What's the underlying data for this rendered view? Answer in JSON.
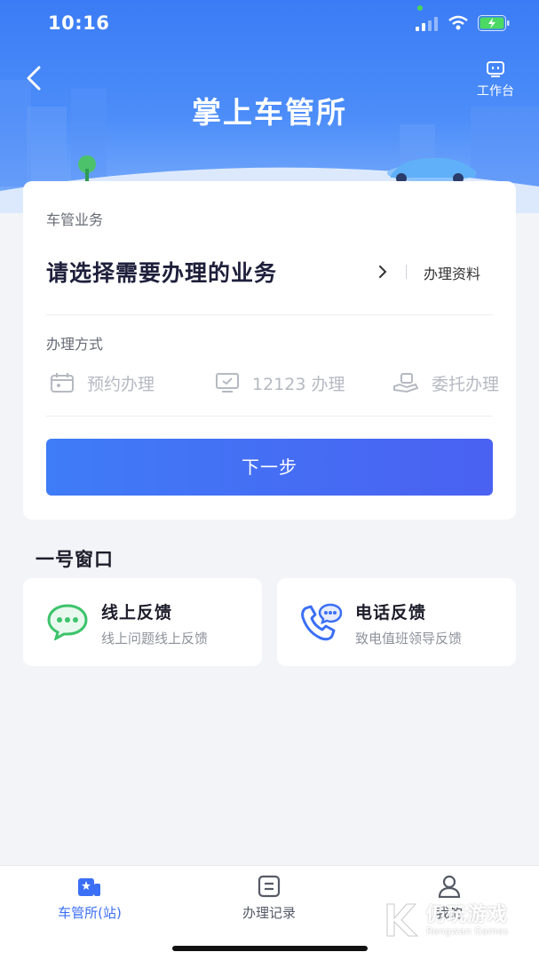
{
  "status_bar": {
    "time": "10:16"
  },
  "header": {
    "title": "掌上车管所",
    "workbench_label": "工作台"
  },
  "business": {
    "section_label": "车管业务",
    "select_prompt": "请选择需要办理的业务",
    "materials_link": "办理资料"
  },
  "methods": {
    "section_label": "办理方式",
    "items": [
      {
        "label": "预约办理",
        "icon": "calendar-icon"
      },
      {
        "label": "12123 办理",
        "icon": "monitor-icon"
      },
      {
        "label": "委托办理",
        "icon": "hand-icon"
      }
    ]
  },
  "next_button": "下一步",
  "window": {
    "title": "一号窗口",
    "cards": [
      {
        "title": "线上反馈",
        "subtitle": "线上问题线上反馈",
        "icon": "chat-bubble-icon"
      },
      {
        "title": "电话反馈",
        "subtitle": "致电值班领导反馈",
        "icon": "phone-chat-icon"
      }
    ]
  },
  "tabs": [
    {
      "label": "车管所(站)",
      "active": true,
      "icon": "station-icon"
    },
    {
      "label": "办理记录",
      "active": false,
      "icon": "record-icon"
    },
    {
      "label": "我的",
      "active": false,
      "icon": "user-icon"
    }
  ],
  "watermark": {
    "text": "仍玩游戏",
    "sub": "Rengwan Games"
  },
  "colors": {
    "primary": "#3f7cf7",
    "accent": "#4a61f1",
    "green": "#3cc36b",
    "active_tab": "#3b6ff5"
  }
}
